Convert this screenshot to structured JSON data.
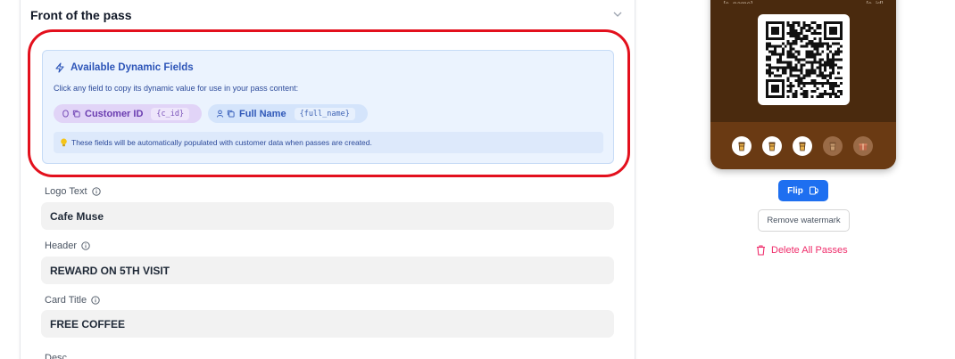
{
  "section": {
    "title": "Front of the pass"
  },
  "dynamic_fields": {
    "heading": "Available Dynamic Fields",
    "instruction": "Click any field to copy its dynamic value for use in your pass content:",
    "chips": [
      {
        "label": "Customer ID",
        "code": "{c_id}",
        "color": "#e1d4f7"
      },
      {
        "label": "Full Name",
        "code": "{full_name}",
        "color": "#d4e4fb"
      }
    ],
    "note": "These fields will be automatically populated with customer data when passes are created."
  },
  "fields": {
    "logo_text": {
      "label": "Logo Text",
      "value": "Cafe Muse"
    },
    "header": {
      "label": "Header",
      "value": "REWARD ON 5TH VISIT"
    },
    "card_title": {
      "label": "Card Title",
      "value": "FREE COFFEE"
    },
    "next_label": "Desc"
  },
  "pass_preview": {
    "background_color": "#4a2a0e",
    "strip_color": "#6a3a13",
    "top_left_text": "{c_name}",
    "top_right_text": "{c_id}",
    "stamps_total": 5,
    "stamps_filled": 3,
    "stamp_icon": "coffee-cup-icon",
    "reward_icon": "gift-icon"
  },
  "actions": {
    "flip_label": "Flip",
    "remove_watermark_label": "Remove watermark",
    "delete_all_label": "Delete All Passes"
  },
  "colors": {
    "highlight": "#e3101d",
    "primary": "#1e6ff0",
    "danger": "#ef2d6b"
  }
}
